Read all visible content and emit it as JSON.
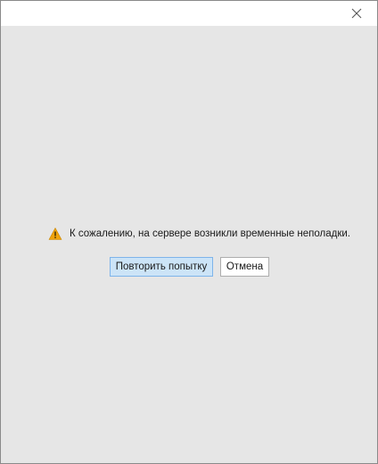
{
  "titlebar": {
    "close_icon": "close-icon"
  },
  "dialog": {
    "warning_icon": "warning-triangle-icon",
    "warning_color": "#f0a30a",
    "message": "К сожалению, на сервере возникли временные неполадки.",
    "retry_label": "Повторить попытку",
    "cancel_label": "Отмена"
  }
}
